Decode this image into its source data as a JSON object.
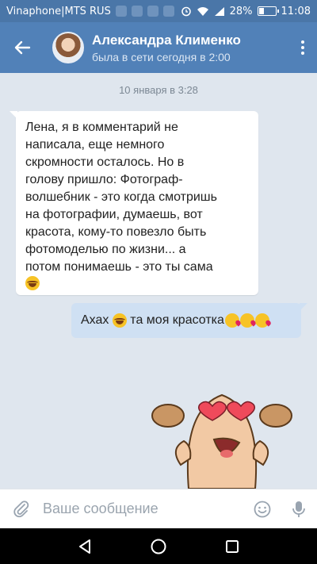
{
  "status_bar": {
    "carrier": "Vinaphone|MTS RUS",
    "battery": "28%",
    "battery_level": 0.28,
    "time": "11:08"
  },
  "header": {
    "contact_name": "Александра Клименко",
    "contact_status": "была в сети сегодня в 2:00",
    "back_icon": "arrow-left-icon",
    "menu_icon": "more-vertical-icon"
  },
  "chat": {
    "date_separator": "10 января в 3:28",
    "incoming": {
      "lines": [
        "Лена, я в комментарий не",
        "написала, еще немного",
        "скромности осталось. Но в",
        "голову пришло: Фотограф-",
        "волшебник - это когда смотришь",
        "на фотографии, думаешь, вот",
        "красота, кому-то повезло быть",
        "фотомоделью по жизни... а",
        "потом понимаешь - это ты сама"
      ],
      "trailing_emoji": "laughing-tears-emoji"
    },
    "outgoing": {
      "text_part1": "Ахах",
      "text_part2": "та моя красотка",
      "emojis": [
        "laughing-tears-emoji",
        "kissing-heart-emoji",
        "kissing-heart-emoji",
        "kissing-heart-emoji"
      ]
    },
    "sticker": "heart-eyes-character-sticker"
  },
  "input_bar": {
    "placeholder": "Ваше сообщение",
    "attach_icon": "paperclip-icon",
    "emoji_icon": "smiley-icon",
    "mic_icon": "microphone-icon"
  },
  "nav_bar": {
    "back_icon": "triangle-back-icon",
    "home_icon": "circle-home-icon",
    "recents_icon": "square-recents-icon"
  },
  "colors": {
    "header": "#5181b8",
    "status_bar": "#4a76a8",
    "chat_bg": "#dfe6ee",
    "outgoing_bubble": "#cfe0f3"
  }
}
